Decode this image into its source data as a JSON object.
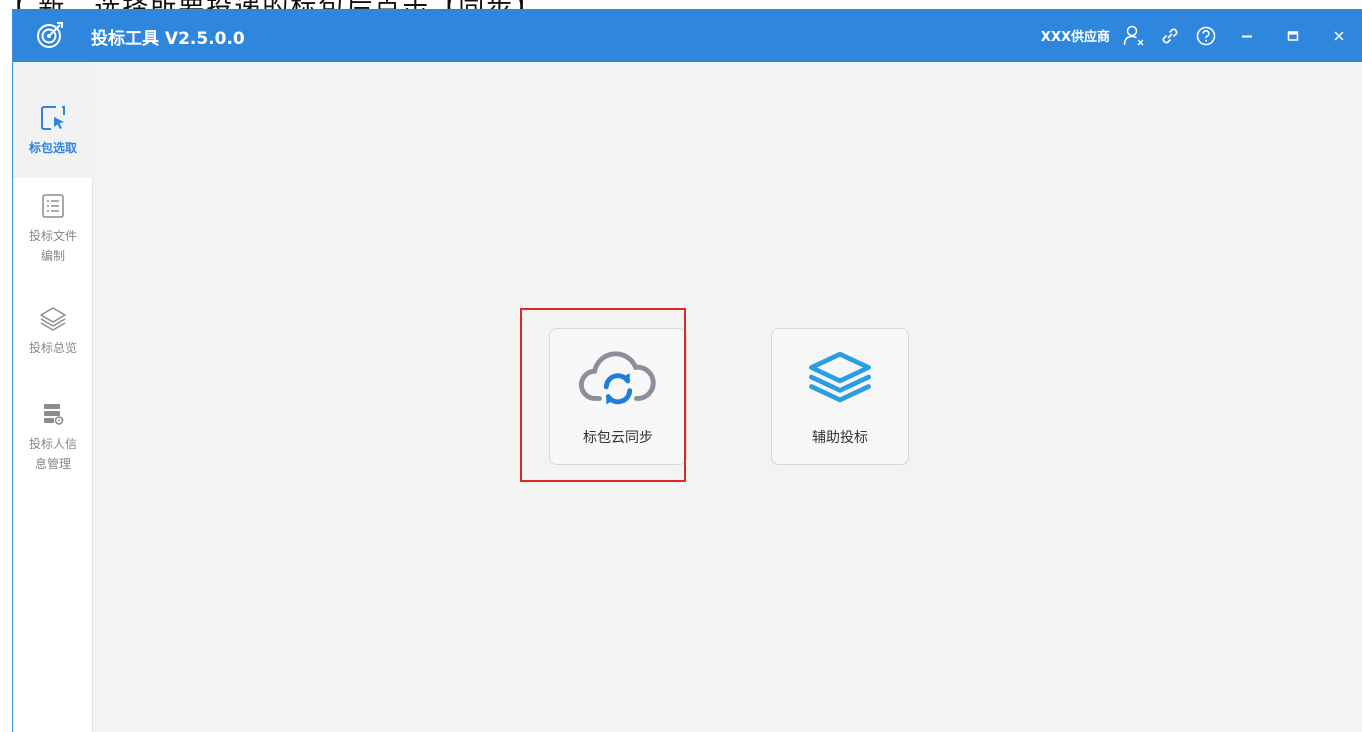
{
  "caption_fragment": "【 新，选择所要投递的标包后点击【同步】",
  "titlebar": {
    "app_title": "投标工具 V2.5.0.0",
    "vendor_name": "XXX供应商",
    "icons": [
      "target-logo-icon",
      "user-logout-icon",
      "link-icon",
      "help-icon",
      "minimize-icon",
      "maximize-icon",
      "close-icon"
    ]
  },
  "sidebar": {
    "items": [
      {
        "label": "标包选取",
        "icon": "cursor-select-icon",
        "active": true
      },
      {
        "label": "投标文件编制",
        "icon": "document-list-icon",
        "active": false
      },
      {
        "label": "投标总览",
        "icon": "layers-icon",
        "active": false
      },
      {
        "label": "投标人信息管理",
        "icon": "server-settings-icon",
        "active": false
      }
    ]
  },
  "main": {
    "cards": [
      {
        "label": "标包云同步",
        "icon": "cloud-sync-icon",
        "highlighted": true
      },
      {
        "label": "辅助投标",
        "icon": "stack-layers-icon",
        "highlighted": false
      }
    ]
  },
  "colors": {
    "titlebar": "#2f86dd",
    "accent": "#2f86dd",
    "highlight": "#e02424",
    "cloud_gray": "#8a8f99",
    "sync_blue": "#1e7fd8",
    "layers_blue": "#2a9ee0"
  }
}
